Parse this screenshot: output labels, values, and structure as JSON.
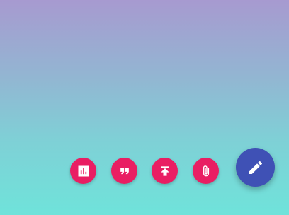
{
  "background": {
    "gradient_top": "#a79ad0",
    "gradient_bottom": "#6fe3da"
  },
  "speed_dial": {
    "actions": [
      {
        "icon": "bar-chart-icon",
        "color": "#e91e63"
      },
      {
        "icon": "quote-icon",
        "color": "#e91e63"
      },
      {
        "icon": "upload-icon",
        "color": "#e91e63"
      },
      {
        "icon": "paperclip-icon",
        "color": "#e91e63"
      }
    ],
    "main_button": {
      "icon": "pencil-icon",
      "color": "#3f51b5"
    }
  }
}
